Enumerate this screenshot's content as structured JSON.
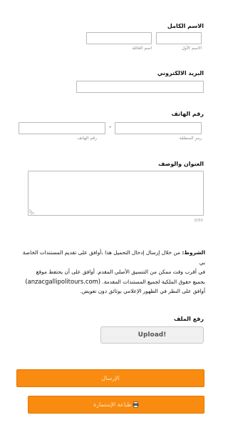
{
  "full_name": {
    "label": "الاسم الكامل",
    "first_name_sub": "الاسم الأول",
    "last_name_sub": "اسم العائلة",
    "first_name_value": "",
    "last_name_value": ""
  },
  "email": {
    "label": "البريد الالكتروني",
    "value": ""
  },
  "phone": {
    "label": "رقم الهاتف",
    "area_code_sub": "رمز المنطقة",
    "number_sub": "رقم الهاتف",
    "separator": "-",
    "area_code_value": "",
    "number_value": ""
  },
  "address": {
    "label": "العنوان والوصف",
    "value": "",
    "counter": "0/50"
  },
  "terms": {
    "heading": "الشروط:",
    "line1": "من خلال إرسال إدخال التحميل هذا ،أوافق على تقديم المستندات الخاصة بي",
    "line2": "في أقرب وقت ممكن من التنسيق الأصلي المقدم. أوافق على أن يحتفظ موقع",
    "site": "(anzacgallipolitours.com)",
    "line3_rest": "بجميع حقوق الملكية لجميع المستندات المقدمة.",
    "line4": "أوافق على النظر في الظهور الإعلامي بوثائق دون تعويض."
  },
  "file_upload": {
    "label": "رفع الملف",
    "button_label": "Upload!"
  },
  "submit": {
    "label": "الإرسال"
  },
  "print": {
    "label": "طباعة الإستمارة",
    "icon": "printer-icon"
  }
}
